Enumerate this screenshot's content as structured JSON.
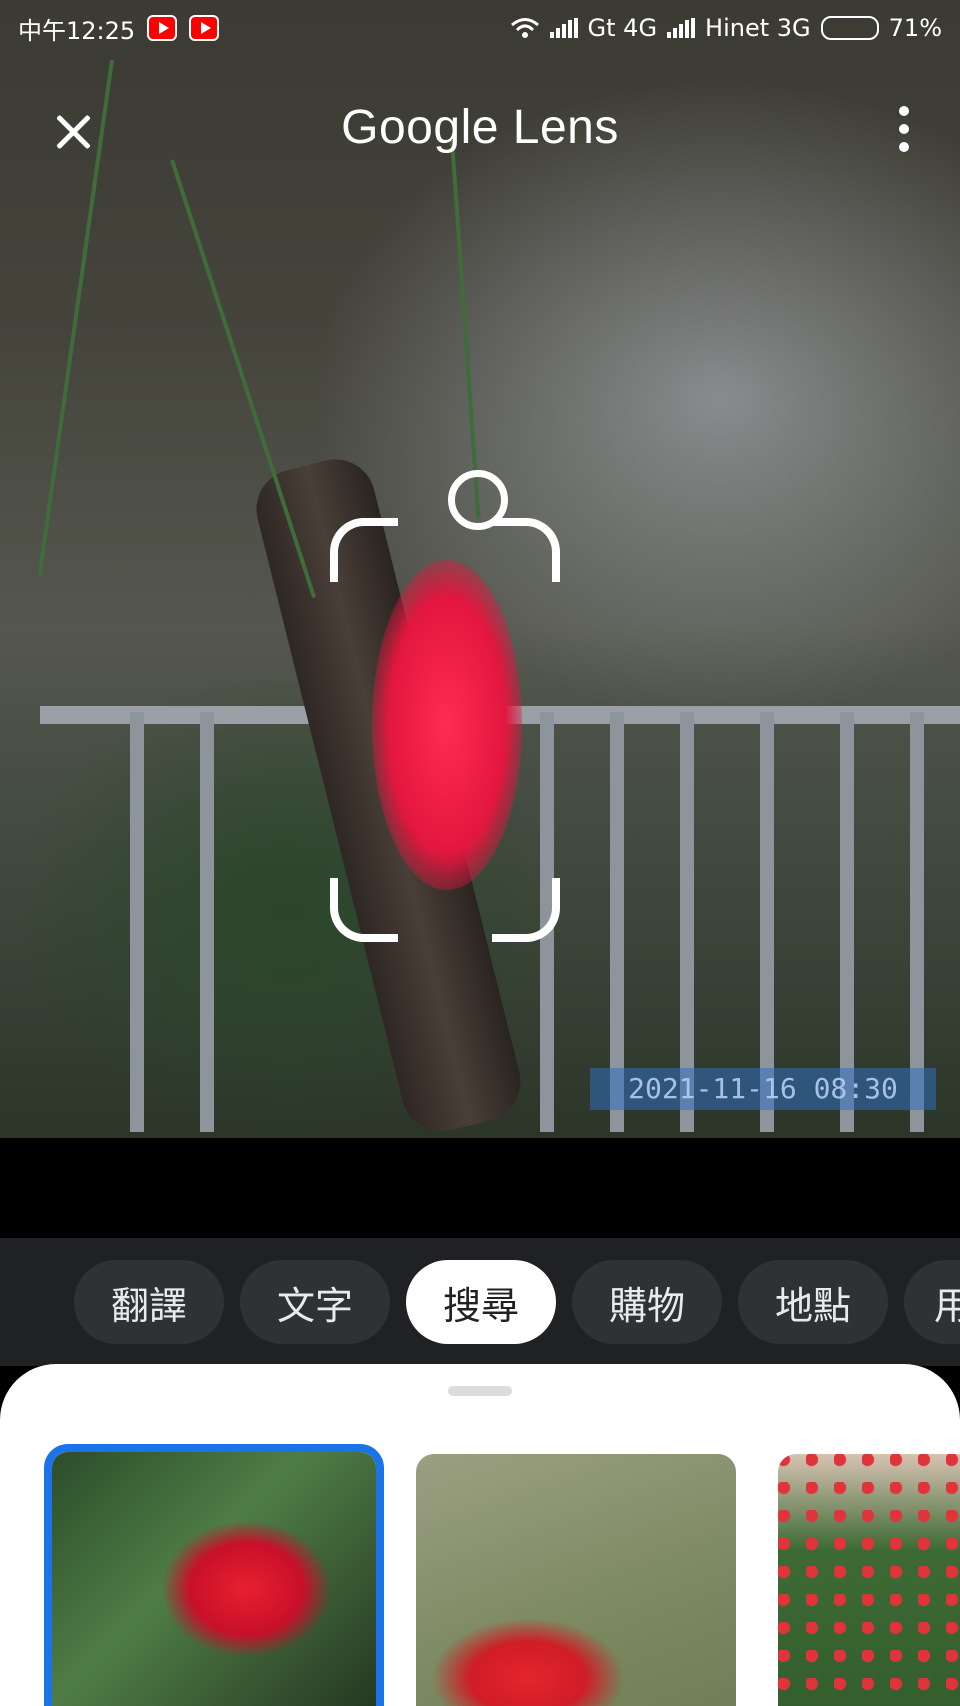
{
  "status_bar": {
    "time": "中午12:25",
    "carrier_1": "Gt 4G",
    "carrier_2": "Hinet 3G",
    "battery": "71%",
    "battery_level": 0.71
  },
  "top_bar": {
    "title": "Google Lens",
    "close_icon": "close-icon",
    "more_icon": "more-vert-icon"
  },
  "photo": {
    "timestamp": "2021-11-16 08:30"
  },
  "modes": {
    "tabs": [
      {
        "label": "翻譯"
      },
      {
        "label": "文字"
      },
      {
        "label": "搜尋"
      },
      {
        "label": "購物"
      },
      {
        "label": "地點"
      },
      {
        "label": "用"
      }
    ],
    "active_index": 2
  },
  "results": {
    "selected_index": 0,
    "item_count_visible": 3
  },
  "colors": {
    "accent": "#1a73e8",
    "chip_bg": "#303134",
    "chip_active_bg": "#ffffff",
    "sheet_bg": "#ffffff"
  }
}
